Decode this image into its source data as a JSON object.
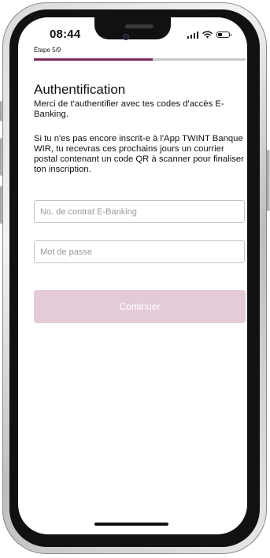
{
  "status_bar": {
    "time": "08:44"
  },
  "progress": {
    "step_label": "Étape 5/9",
    "current_step": 5,
    "total_steps": 9,
    "fill_fraction": 0.56,
    "accent_color": "#7b2a5b",
    "track_color": "#c9c9c9"
  },
  "page": {
    "title": "Authentification",
    "intro": "Merci de t'authentifier avec tes codes d'accès E-Banking.",
    "info": "Si tu n'es pas encore inscrit-e à l'App TWINT Banque WIR, tu recevras ces prochains jours un courrier postal contenant un code QR à scanner pour finaliser ton inscription."
  },
  "form": {
    "contract_field": {
      "placeholder": "No. de contrat E-Banking",
      "value": ""
    },
    "password_field": {
      "placeholder": "Mot de passe",
      "value": ""
    },
    "continue_label": "Continuer",
    "continue_color": "#e5cad8"
  },
  "icons": {
    "signal": "cellular-signal-icon",
    "wifi": "wifi-icon",
    "battery": "battery-icon"
  }
}
